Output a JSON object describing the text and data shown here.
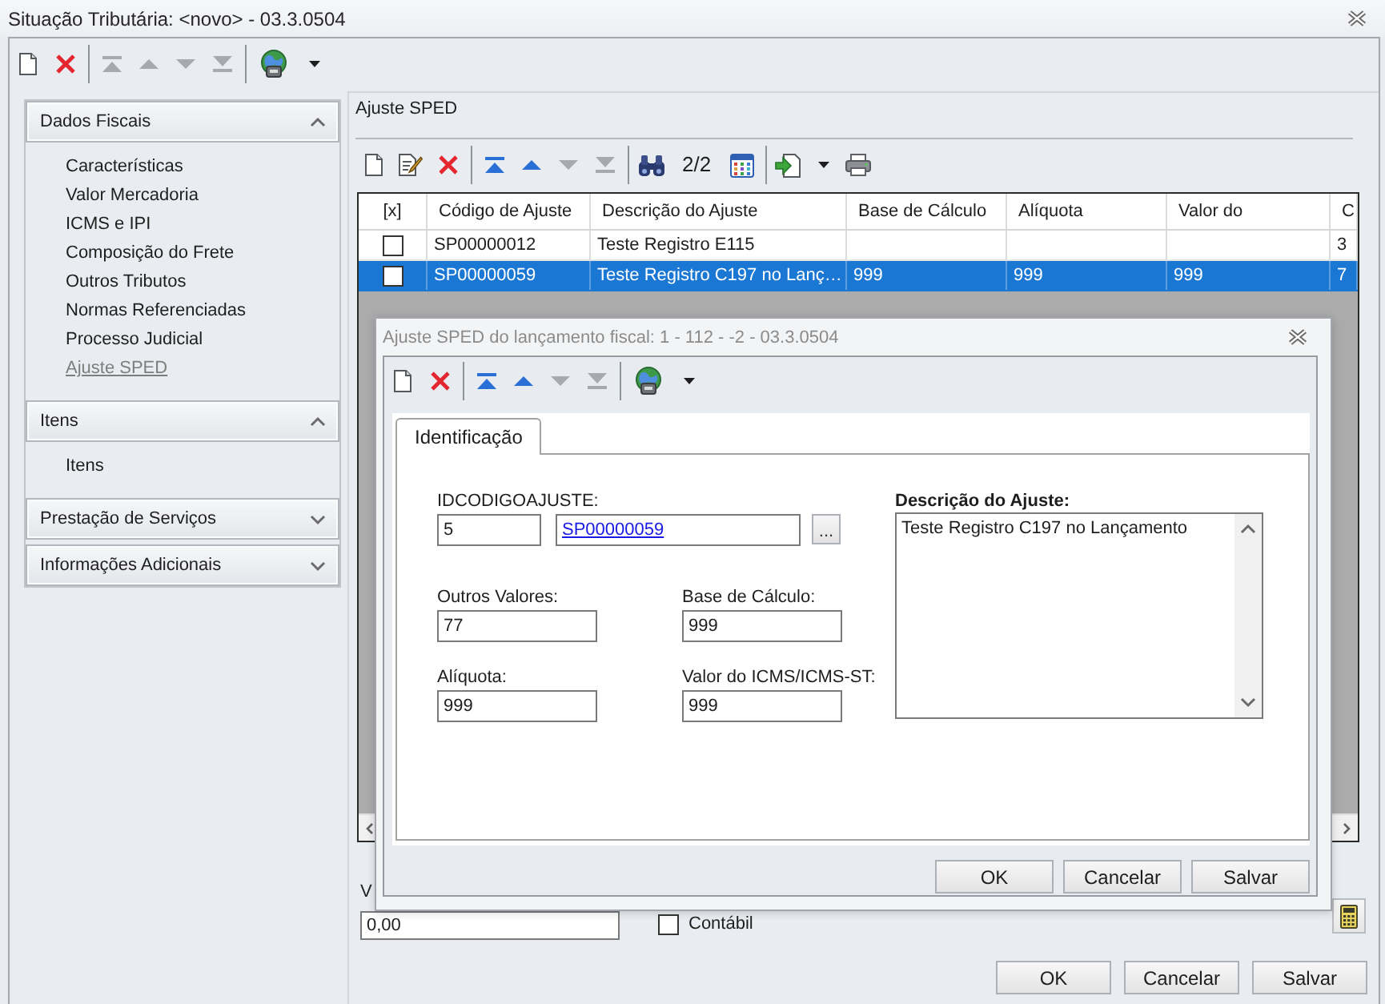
{
  "window": {
    "title": "Situação Tributária: <novo> - 03.3.0504"
  },
  "toolbar": [
    {
      "buttons": [
        {
          "kind": "new",
          "disabled": false
        },
        {
          "kind": "delete",
          "disabled": false
        }
      ]
    },
    {
      "buttons": [
        {
          "kind": "first",
          "disabled": true
        },
        {
          "kind": "previous",
          "disabled": true
        },
        {
          "kind": "next",
          "disabled": true
        },
        {
          "kind": "last",
          "disabled": true
        }
      ]
    },
    {
      "buttons": [
        {
          "kind": "globe",
          "disabled": false
        },
        {
          "kind": "dropdown",
          "disabled": false
        }
      ]
    }
  ],
  "sidebar": {
    "sections": [
      {
        "title": "Dados Fiscais",
        "expanded": true,
        "items": [
          {
            "label": "Características",
            "selected": false
          },
          {
            "label": "Valor Mercadoria",
            "selected": false
          },
          {
            "label": "ICMS e IPI",
            "selected": false
          },
          {
            "label": "Composição do Frete",
            "selected": false
          },
          {
            "label": "Outros Tributos",
            "selected": false
          },
          {
            "label": "Normas Referenciadas",
            "selected": false
          },
          {
            "label": "Processo Judicial",
            "selected": false
          },
          {
            "label": "Ajuste SPED",
            "selected": true
          }
        ]
      },
      {
        "title": "Itens",
        "expanded": true,
        "items": [
          {
            "label": "Itens",
            "selected": false
          }
        ]
      },
      {
        "title": "Prestação de Serviços",
        "expanded": false
      },
      {
        "title": "Informações Adicionais",
        "expanded": false
      }
    ]
  },
  "panel": {
    "title": "Ajuste SPED",
    "toolbar": [
      {
        "buttons": [
          {
            "kind": "new",
            "disabled": false
          },
          {
            "kind": "edit",
            "disabled": false
          },
          {
            "kind": "delete",
            "disabled": false
          }
        ]
      },
      {
        "buttons": [
          {
            "kind": "first",
            "disabled": false
          },
          {
            "kind": "previous",
            "disabled": false
          },
          {
            "kind": "next",
            "disabled": true
          },
          {
            "kind": "last",
            "disabled": true
          }
        ]
      },
      {
        "buttons": [
          {
            "kind": "find",
            "disabled": false
          },
          {
            "kind": "counter",
            "text": "2/2",
            "disabled": false
          },
          {
            "kind": "columns",
            "disabled": false
          }
        ]
      },
      {
        "buttons": [
          {
            "kind": "export",
            "disabled": false
          },
          {
            "kind": "dropdown",
            "disabled": false
          },
          {
            "kind": "print",
            "disabled": false
          }
        ]
      }
    ],
    "grid": {
      "check_header": "[x]",
      "columns": [
        "Código de Ajuste",
        "Descrição do Ajuste",
        "Base de Cálculo",
        "Alíquota",
        "Valor do",
        "C"
      ],
      "rows": [
        {
          "checked": false,
          "selected": false,
          "cells": [
            "SP00000012",
            "Teste Registro E115",
            null,
            null,
            null,
            "3"
          ]
        },
        {
          "checked": false,
          "selected": true,
          "cells": [
            "SP00000059",
            "Teste Registro C197 no Lanç…",
            "999",
            "999",
            "999",
            "7"
          ]
        }
      ]
    },
    "form": {
      "label": "V",
      "value": "0,00",
      "checkbox": {
        "label": "Contábil",
        "checked": false
      }
    },
    "buttons": [
      "OK",
      "Cancelar",
      "Salvar"
    ]
  },
  "dialog": {
    "title": "Ajuste SPED do lançamento fiscal: 1 - 112 - -2 - 03.3.0504",
    "toolbar": [
      {
        "buttons": [
          {
            "kind": "new",
            "disabled": false
          },
          {
            "kind": "delete",
            "disabled": false
          }
        ]
      },
      {
        "buttons": [
          {
            "kind": "first",
            "disabled": false
          },
          {
            "kind": "previous",
            "disabled": false
          },
          {
            "kind": "next",
            "disabled": true
          },
          {
            "kind": "last",
            "disabled": true
          }
        ]
      },
      {
        "buttons": [
          {
            "kind": "globe",
            "disabled": false
          },
          {
            "kind": "dropdown",
            "disabled": false
          }
        ]
      }
    ],
    "tabs": [
      {
        "label": "Identificação",
        "selected": true
      }
    ],
    "fields": {
      "id_codigo_ajuste": {
        "label": "IDCODIGOAJUSTE:",
        "value": "5",
        "code": "SP00000059",
        "lookup": "..."
      },
      "outros_valores": {
        "label": "Outros Valores:",
        "value": "77"
      },
      "base_de_calculo": {
        "label": "Base de Cálculo:",
        "value": "999"
      },
      "aliquota": {
        "label": "Alíquota:",
        "value": "999"
      },
      "valor_icms": {
        "label": "Valor do ICMS/ICMS-ST:",
        "value": "999"
      },
      "descricao": {
        "label": "Descrição do Ajuste:",
        "value": "Teste Registro C197 no Lançamento"
      }
    },
    "buttons": [
      "OK",
      "Cancelar",
      "Salvar"
    ]
  }
}
